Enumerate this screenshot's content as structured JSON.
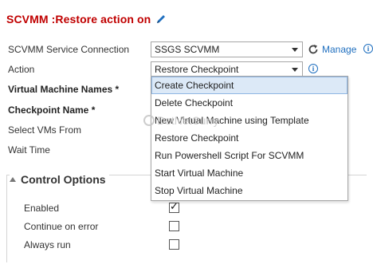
{
  "page": {
    "title": "SCVMM :Restore action on"
  },
  "form": {
    "connection_label": "SCVMM Service Connection",
    "connection_value": "SSGS SCVMM",
    "manage_label": "Manage",
    "action_label": "Action",
    "action_value": "Restore Checkpoint",
    "vm_names_label": "Virtual Machine Names *",
    "checkpoint_label": "Checkpoint Name *",
    "select_vms_label": "Select VMs From",
    "wait_time_label": "Wait Time"
  },
  "action_dropdown": {
    "options": [
      "Create Checkpoint",
      "Delete Checkpoint",
      "New Virtual Machine using Template",
      "Restore Checkpoint",
      "Run Powershell Script For SCVMM",
      "Start Virtual Machine",
      "Stop Virtual Machine"
    ],
    "highlighted": "Create Checkpoint"
  },
  "watermark": {
    "text": "DotNetCurry"
  },
  "control_options": {
    "title": "Control Options",
    "enabled_label": "Enabled",
    "enabled_checked": true,
    "continue_label": "Continue on error",
    "continue_checked": false,
    "always_label": "Always run",
    "always_checked": false
  },
  "colors": {
    "title": "#c00000",
    "link": "#1f6fbf",
    "highlight": "#dce9f7"
  },
  "icons": {
    "edit": "pencil-icon",
    "refresh": "refresh-icon",
    "info": "info-icon",
    "collapse": "triangle-up-icon",
    "watermark": "watermark-logo-icon"
  }
}
